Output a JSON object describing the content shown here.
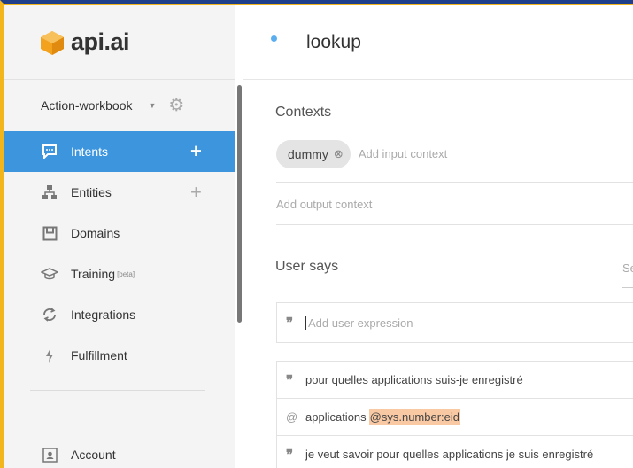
{
  "brand": {
    "logo_text": "api.ai",
    "logo_color": "#f2a21c"
  },
  "colors": {
    "accent": "#3c95dd",
    "top_border": "#1f3f8a",
    "frame_border": "#f2b51c",
    "param_highlight": "#f9c9a4"
  },
  "sidebar": {
    "agent_name": "Action-workbook",
    "items": [
      {
        "label": "Intents",
        "icon": "chat-icon",
        "active": true,
        "has_add": true
      },
      {
        "label": "Entities",
        "icon": "hierarchy-icon",
        "active": false,
        "has_add": true
      },
      {
        "label": "Domains",
        "icon": "box-icon",
        "active": false,
        "has_add": false
      },
      {
        "label": "Training",
        "badge": "[beta]",
        "icon": "graduation-cap-icon",
        "active": false,
        "has_add": false
      },
      {
        "label": "Integrations",
        "icon": "sync-icon",
        "active": false,
        "has_add": false
      },
      {
        "label": "Fulfillment",
        "icon": "lightning-icon",
        "active": false,
        "has_add": false
      }
    ],
    "account_label": "Account"
  },
  "intent": {
    "name": "lookup",
    "contexts_title": "Contexts",
    "input_context_chip": "dummy",
    "input_context_placeholder": "Add input context",
    "output_context_placeholder": "Add output context",
    "user_says_title": "User says",
    "search_placeholder_partial": "Se",
    "add_expression_placeholder": "Add user expression",
    "expressions": [
      {
        "kind": "example",
        "text": "pour quelles applications suis-je enregistré"
      },
      {
        "kind": "template",
        "text": "applications",
        "param": "@sys.number:eid"
      },
      {
        "kind": "example",
        "text": "je veut savoir pour quelles applications je suis enregistré"
      }
    ]
  }
}
